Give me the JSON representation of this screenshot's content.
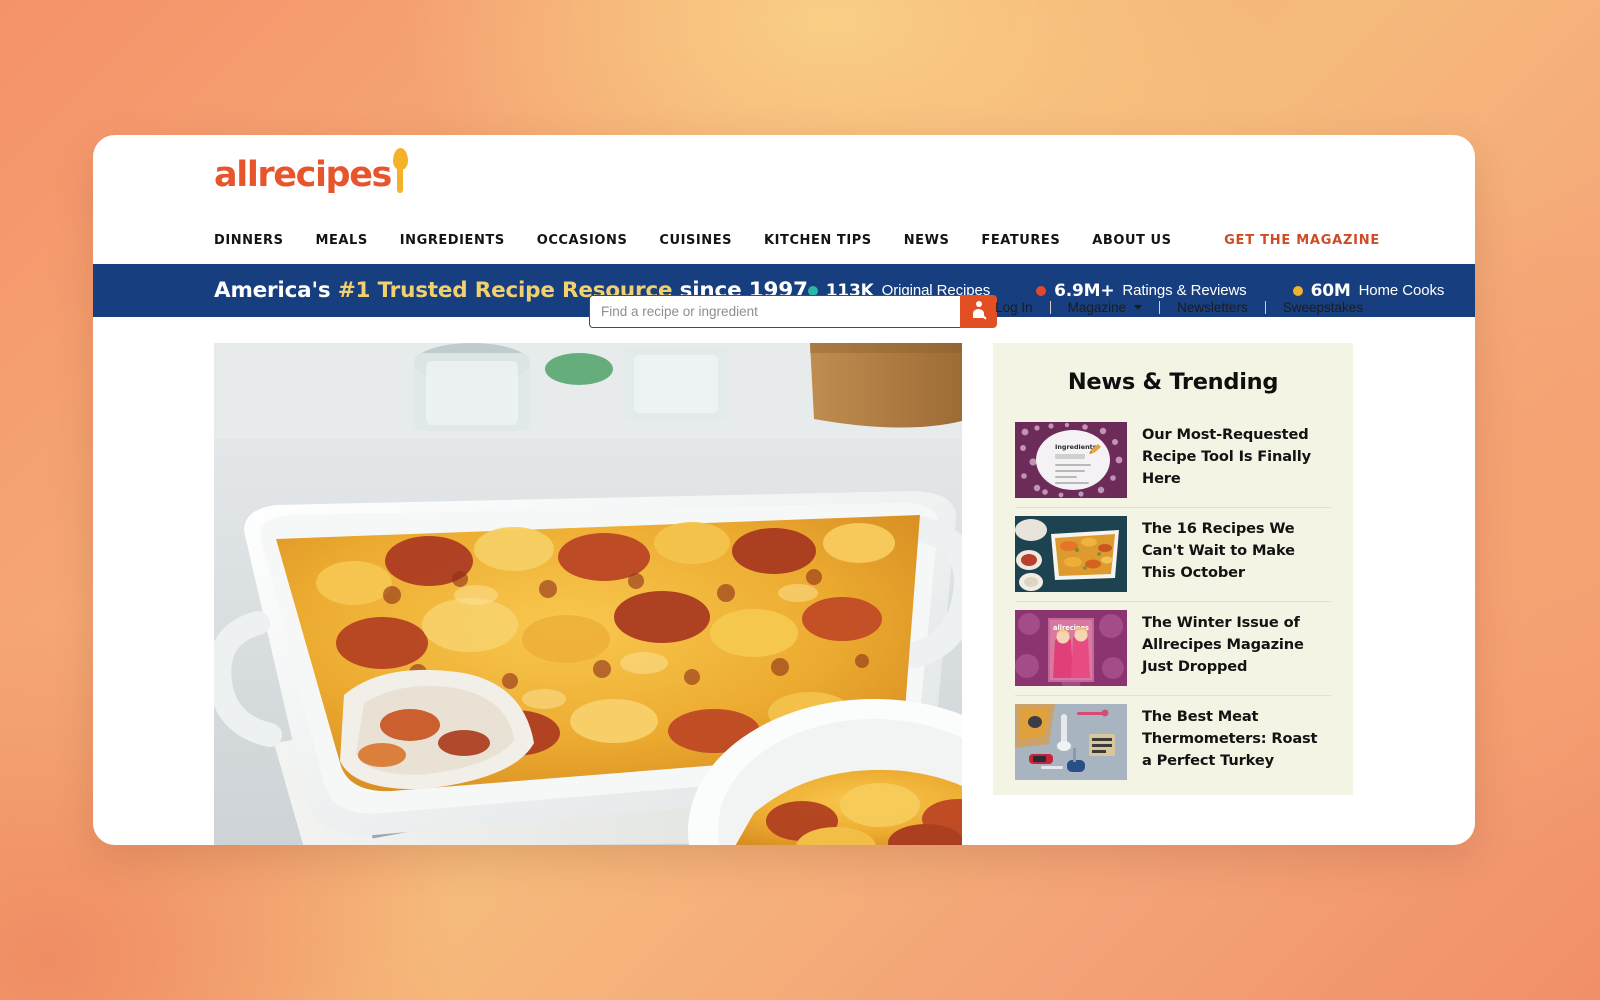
{
  "brand": {
    "logo_text": "allrecipes",
    "logo_icon": "spoon-icon",
    "accent_orange": "#e8542b",
    "spoon_yellow": "#f3b229"
  },
  "search": {
    "placeholder": "Find a recipe or ingredient",
    "value": "",
    "button_icon": "search-icon",
    "button_color": "#e14f22"
  },
  "utility_nav": {
    "login": "Log In",
    "magazine": "Magazine",
    "newsletters": "Newsletters",
    "sweepstakes": "Sweepstakes"
  },
  "main_nav": {
    "items": [
      {
        "label": "DINNERS"
      },
      {
        "label": "MEALS"
      },
      {
        "label": "INGREDIENTS"
      },
      {
        "label": "OCCASIONS"
      },
      {
        "label": "CUISINES"
      },
      {
        "label": "KITCHEN TIPS"
      },
      {
        "label": "NEWS"
      },
      {
        "label": "FEATURES"
      },
      {
        "label": "ABOUT US"
      }
    ],
    "cta": "GET THE MAGAZINE",
    "cta_color": "#cf4b23"
  },
  "trust_bar": {
    "background": "#173f7f",
    "highlight_color": "#f2d070",
    "text_prefix": "America's ",
    "text_highlight": "#1 Trusted Recipe Resource",
    "text_suffix": " since 1997",
    "stats": [
      {
        "number": "113K",
        "label": "Original Recipes",
        "dot_color": "#2bb6a8"
      },
      {
        "number": "6.9M+",
        "label": "Ratings & Reviews",
        "dot_color": "#e4482c"
      },
      {
        "number": "60M",
        "label": "Home Cooks",
        "dot_color": "#efb22e"
      }
    ]
  },
  "hero": {
    "alt": "Cheesy beef and noodle casserole in a white baking dish with a serving plate"
  },
  "sidebar": {
    "title": "News & Trending",
    "background": "#f4f4e4",
    "items": [
      {
        "title": "Our Most-Requested Recipe Tool Is Finally Here",
        "thumb": "ingredients-list-graphic"
      },
      {
        "title": "The 16 Recipes We Can't Wait to Make This October",
        "thumb": "casserole-dish-photo"
      },
      {
        "title": "The Winter Issue of Allrecipes Magazine Just Dropped",
        "thumb": "magazine-cover-photo"
      },
      {
        "title": "The Best Meat Thermometers: Roast a Perfect Turkey",
        "thumb": "meat-thermometers-photo"
      }
    ]
  }
}
